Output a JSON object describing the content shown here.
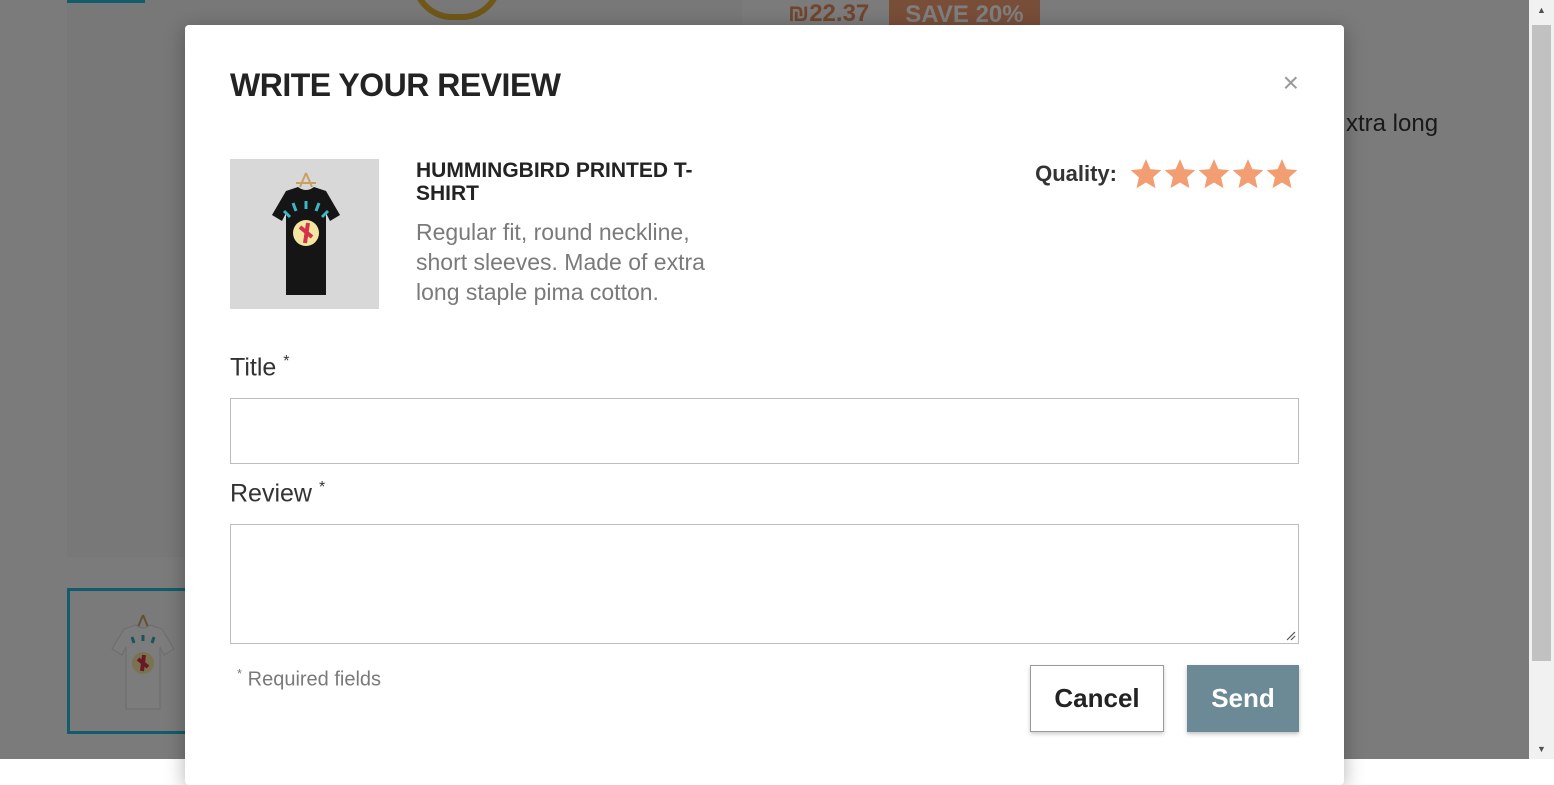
{
  "background": {
    "price": "₪22.37",
    "discount": "SAVE 20%",
    "description_fragment": "xtra long"
  },
  "modal": {
    "title": "WRITE YOUR REVIEW",
    "close_label": "×",
    "product": {
      "name": "HUMMINGBIRD PRINTED T-SHIRT",
      "description": "Regular fit, round neckline, short sleeves. Made of extra long staple pima cotton.",
      "image_icon": "black-tshirt-hummingbird"
    },
    "quality": {
      "label": "Quality:",
      "stars": 5,
      "rating": 5,
      "star_color": "#f39d72"
    },
    "fields": {
      "title_label": "Title",
      "review_label": "Review",
      "required_mark": "*",
      "title_value": "",
      "review_value": ""
    },
    "required_note": "Required fields",
    "buttons": {
      "cancel": "Cancel",
      "send": "Send"
    }
  },
  "colors": {
    "accent": "#24b9d7",
    "send_button": "#6b8a96",
    "discount_badge": "#f39d72"
  }
}
